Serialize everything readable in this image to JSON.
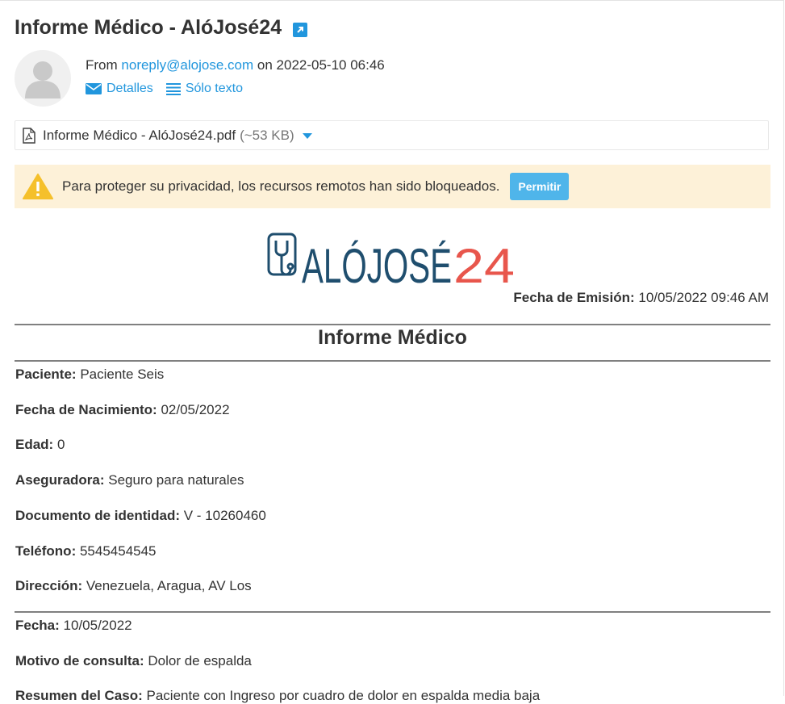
{
  "email": {
    "subject": "Informe Médico - AlóJosé24",
    "from_prefix": "From",
    "from_address": "noreply@alojose.com",
    "date_prefix": "on",
    "date": "2022-05-10 06:46",
    "details_label": "Detalles",
    "plain_text_label": "Sólo texto"
  },
  "attachment": {
    "name": "Informe Médico - AlóJosé24.pdf",
    "size": "(~53 KB)"
  },
  "privacy_banner": {
    "message": "Para proteger su privacidad, los recursos remotos han sido bloqueados.",
    "allow_label": "Permitir"
  },
  "report": {
    "logo_text_left": "ALÓJOSÉ",
    "logo_text_right": "24",
    "issue_date_label": "Fecha de Emisión:",
    "issue_date_value": "10/05/2022 09:46 AM",
    "title": "Informe Médico",
    "patient_fields": [
      {
        "label": "Paciente:",
        "value": "Paciente Seis"
      },
      {
        "label": "Fecha de Nacimiento:",
        "value": "02/05/2022"
      },
      {
        "label": "Edad:",
        "value": "0"
      },
      {
        "label": "Aseguradora:",
        "value": "Seguro para naturales"
      },
      {
        "label": "Documento de identidad:",
        "value": "V - 10260460"
      },
      {
        "label": "Teléfono:",
        "value": "5545454545"
      },
      {
        "label": "Dirección:",
        "value": "Venezuela, Aragua, AV Los"
      }
    ],
    "consult_fields": [
      {
        "label": "Fecha:",
        "value": "10/05/2022"
      },
      {
        "label": "Motivo de consulta:",
        "value": "Dolor de espalda"
      },
      {
        "label": "Resumen del Caso:",
        "value": "Paciente con Ingreso por cuadro de dolor en espalda media baja"
      }
    ]
  },
  "colors": {
    "link": "#2196dd",
    "banner_bg": "#fdf1d8",
    "warning_icon": "#f5c02b",
    "allow_button": "#4fb5ea",
    "logo_blue": "#1f4e6e",
    "logo_red": "#e8564c"
  }
}
